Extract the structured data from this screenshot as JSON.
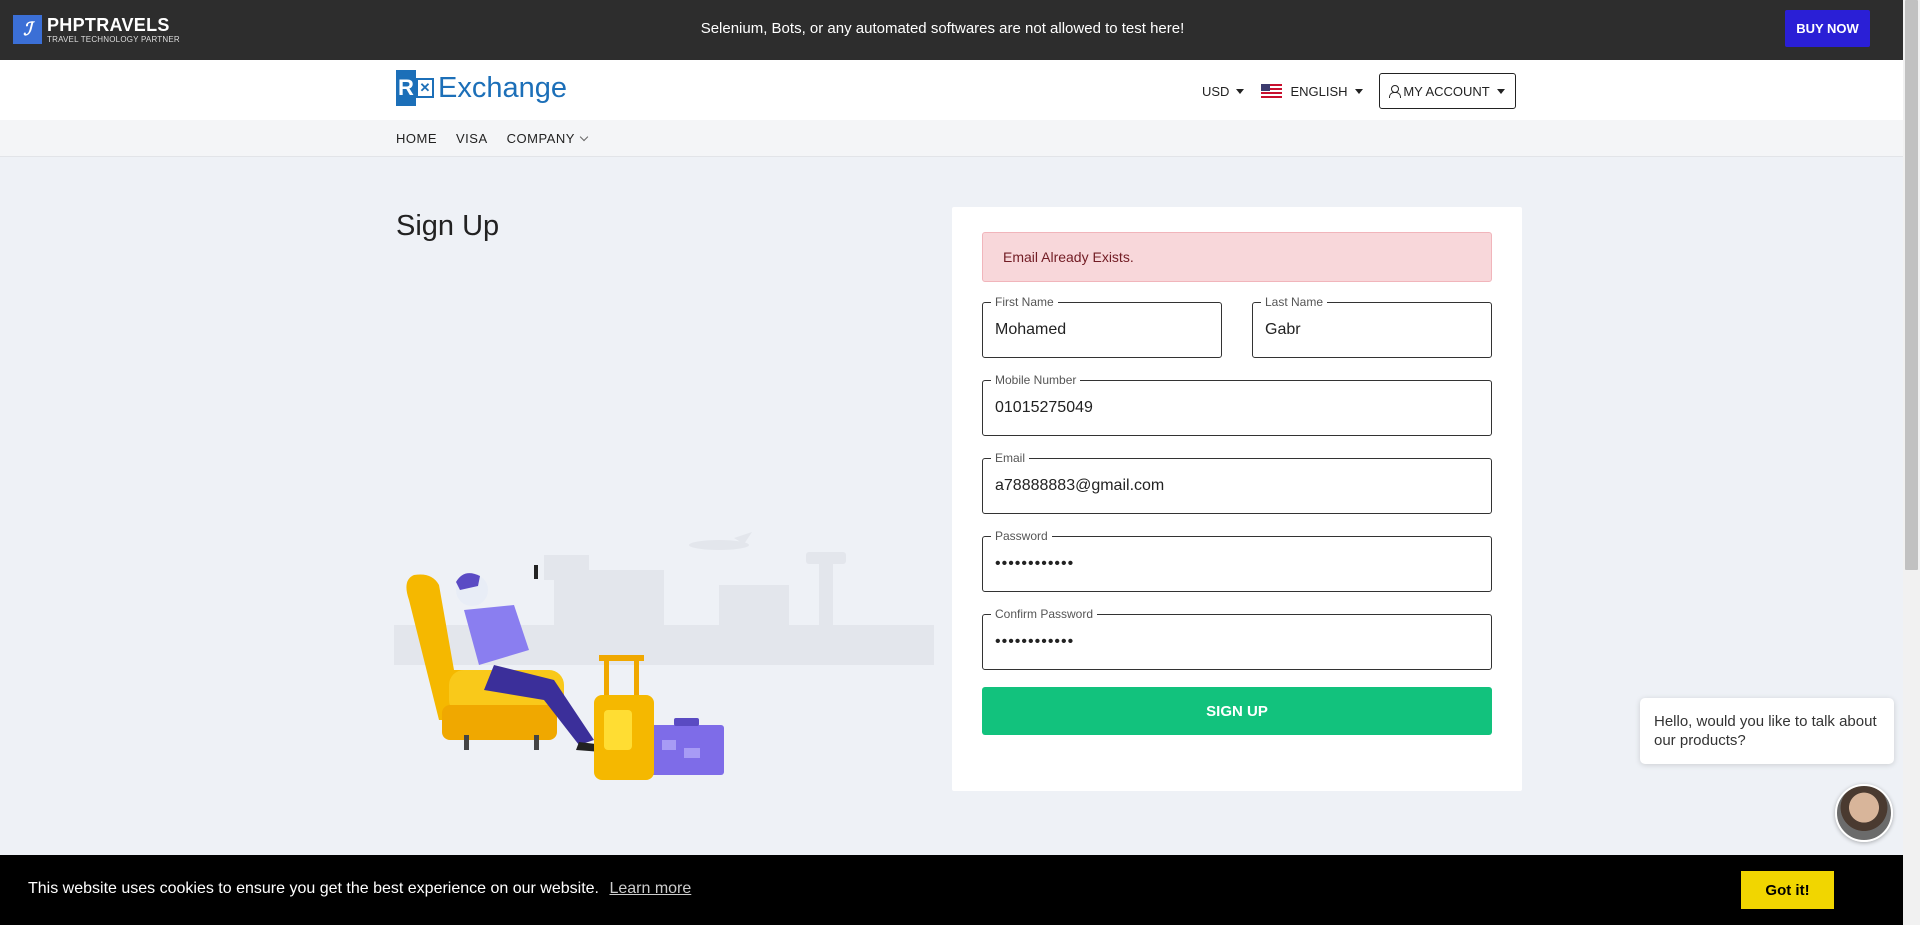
{
  "topbar": {
    "logo_title": "PHPTRAVELS",
    "logo_subtitle": "TRAVEL TECHNOLOGY PARTNER",
    "notice": "Selenium, Bots, or any automated softwares are not allowed to test here!",
    "buy_now": "BUY NOW"
  },
  "header": {
    "brand_text": "Exchange",
    "currency": "USD",
    "language": "ENGLISH",
    "account": "MY ACCOUNT"
  },
  "nav": {
    "items": [
      "HOME",
      "VISA",
      "COMPANY"
    ]
  },
  "page": {
    "title": "Sign Up"
  },
  "form": {
    "alert": "Email Already Exists.",
    "first_name": {
      "label": "First Name",
      "value": "Mohamed"
    },
    "last_name": {
      "label": "Last Name",
      "value": "Gabr"
    },
    "mobile": {
      "label": "Mobile Number",
      "value": "01015275049"
    },
    "email": {
      "label": "Email",
      "value": "a78888883@gmail.com"
    },
    "password": {
      "label": "Password",
      "value": "••••••••••••"
    },
    "confirm_password": {
      "label": "Confirm Password",
      "value": "••••••••••••"
    },
    "submit": "SIGN UP"
  },
  "chat": {
    "message": "Hello, would you like to talk about our products?"
  },
  "cookie": {
    "text": "This website uses cookies to ensure you get the best experience on our website.",
    "learn_more": "Learn more",
    "accept": "Got it!"
  },
  "colors": {
    "topbar_bg": "#2d2d2d",
    "buy_now": "#2a1fd6",
    "brand": "#1c6fb8",
    "alert_bg": "#f8d7da",
    "signup": "#12c27d",
    "cookie_accept": "#f1d600"
  }
}
